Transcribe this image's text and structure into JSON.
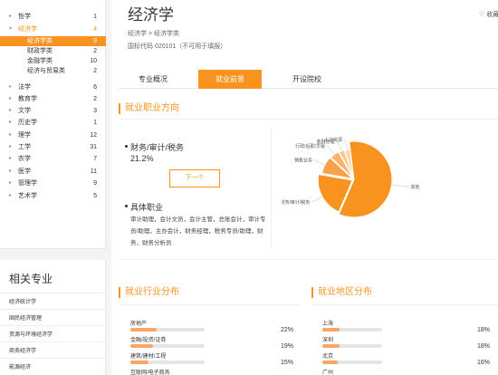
{
  "sidebar": {
    "subjects": [
      {
        "label": "哲学",
        "count": "1",
        "arrow": "▸",
        "level": 0
      },
      {
        "label": "经济学",
        "count": "4",
        "arrow": "▾",
        "level": 0
      },
      {
        "label": "经济学类",
        "count": "9",
        "arrow": "",
        "level": 1
      },
      {
        "label": "财政学类",
        "count": "2",
        "arrow": "",
        "level": 1
      },
      {
        "label": "金融学类",
        "count": "10",
        "arrow": "",
        "level": 1
      },
      {
        "label": "经济与贸易类",
        "count": "2",
        "arrow": "",
        "level": 1
      },
      {
        "label": "法学",
        "count": "6",
        "arrow": "▸",
        "level": 0
      },
      {
        "label": "教育学",
        "count": "2",
        "arrow": "▸",
        "level": 0
      },
      {
        "label": "文学",
        "count": "3",
        "arrow": "▸",
        "level": 0
      },
      {
        "label": "历史学",
        "count": "1",
        "arrow": "▸",
        "level": 0
      },
      {
        "label": "理学",
        "count": "12",
        "arrow": "▸",
        "level": 0
      },
      {
        "label": "工学",
        "count": "31",
        "arrow": "▸",
        "level": 0
      },
      {
        "label": "农学",
        "count": "7",
        "arrow": "▸",
        "level": 0
      },
      {
        "label": "医学",
        "count": "11",
        "arrow": "▸",
        "level": 0
      },
      {
        "label": "管理学",
        "count": "9",
        "arrow": "▸",
        "level": 0
      },
      {
        "label": "艺术学",
        "count": "5",
        "arrow": "▸",
        "level": 0
      }
    ]
  },
  "related": {
    "title": "相关专业",
    "items": [
      "经济统计学",
      "国民经济管理",
      "资源与环境经济学",
      "商务经济学",
      "能源经济"
    ]
  },
  "header": {
    "title": "经济学",
    "favorite": "收藏",
    "breadcrumb": "经济学 > 经济学类",
    "code": "国标代码 020101（不可用于填报）"
  },
  "tabs": [
    "专业概况",
    "就业前景",
    "开设院校"
  ],
  "career": {
    "section_title": "就业职业方向",
    "top_name": "财务/审计/税务",
    "top_pct": "21.2%",
    "next_label": "下一个",
    "jobs_title": "具体职业",
    "jobs_text": "审计助理，会计文员，会计主管，总账会计，审计专员/助理，主办会计，财务经理，税务专员/助理，财务，财务分析员"
  },
  "industry": {
    "section_title": "就业行业分布",
    "items": [
      {
        "name": "房地产",
        "pct": "22%",
        "value": 0.22
      },
      {
        "name": "金融/投资/证券",
        "pct": "19%",
        "value": 0.19
      },
      {
        "name": "建筑/建材/工程",
        "pct": "15%",
        "value": 0.15
      },
      {
        "name": "互联网/电子商务",
        "pct": "",
        "value": 0
      }
    ]
  },
  "region": {
    "section_title": "就业地区分布",
    "items": [
      {
        "name": "上海",
        "pct": "18%",
        "value": 0.18
      },
      {
        "name": "深圳",
        "pct": "18%",
        "value": 0.18
      },
      {
        "name": "北京",
        "pct": "16%",
        "value": 0.16
      },
      {
        "name": "广州",
        "pct": "",
        "value": 0
      }
    ]
  },
  "chart_data": {
    "type": "pie",
    "slices": [
      {
        "label": "其他",
        "value": 58.5,
        "color": "#f7931e"
      },
      {
        "label": "财务/审计/税务",
        "value": 21.2,
        "color": "#f7931e"
      },
      {
        "label": "销售业务",
        "value": 9.2,
        "color": "#f8a04a"
      },
      {
        "label": "行政/后勤/文秘",
        "value": 5.0,
        "color": "#f9b36d"
      },
      {
        "label": "金融管理",
        "value": 3.0,
        "color": "#fbc68f"
      },
      {
        "label": "人力资源",
        "value": 3.1,
        "color": "#fcd6ad"
      }
    ]
  },
  "colors": {
    "accent": "#f7931e",
    "bar_fill": "#f7a668",
    "bar_track": "#e5e5e5"
  }
}
